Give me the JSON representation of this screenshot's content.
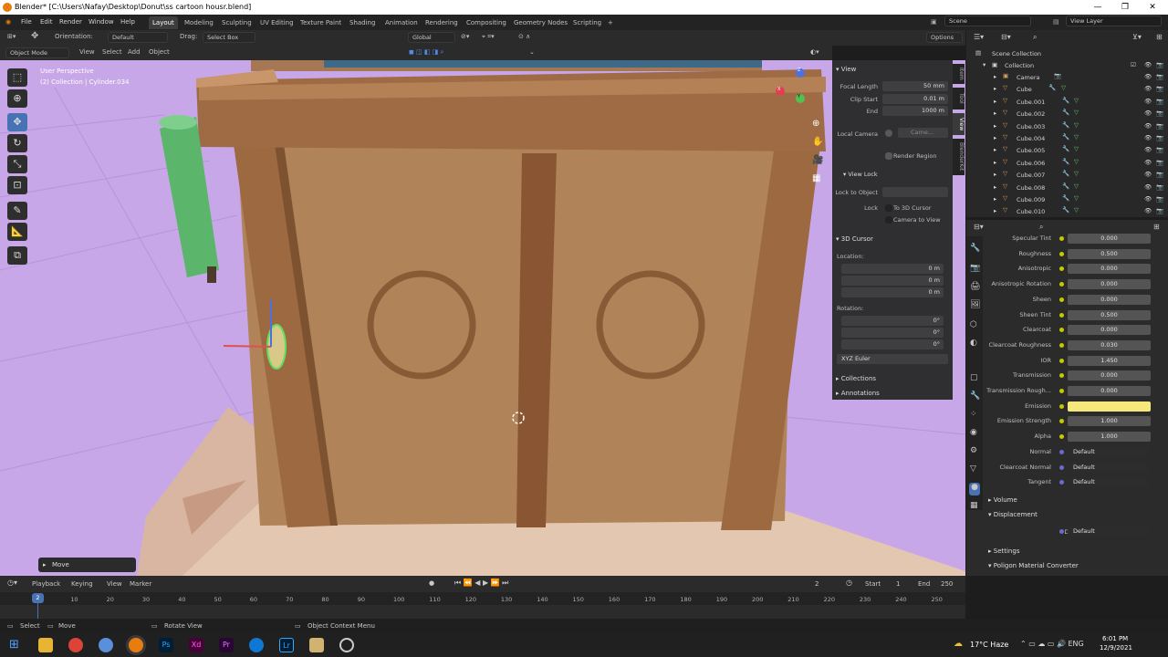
{
  "window": {
    "title": "Blender* [C:\\Users\\Nafay\\Desktop\\Donut\\ss cartoon housr.blend]"
  },
  "menu": [
    "File",
    "Edit",
    "Render",
    "Window",
    "Help"
  ],
  "workspaces": [
    "Layout",
    "Modeling",
    "Sculpting",
    "UV Editing",
    "Texture Paint",
    "Shading",
    "Animation",
    "Rendering",
    "Compositing",
    "Geometry Nodes",
    "Scripting",
    "+"
  ],
  "scene": {
    "label": "Scene",
    "view_layer": "View Layer"
  },
  "toolbar": {
    "orientation_label": "Orientation:",
    "orientation_value": "Default",
    "drag_label": "Drag:",
    "drag_value": "Select Box",
    "transform": "Global",
    "options": "Options"
  },
  "header2": {
    "mode": "Object Mode",
    "items": [
      "View",
      "Select",
      "Add",
      "Object"
    ]
  },
  "viewport": {
    "perspective": "User Perspective",
    "collection_info": "(2) Collection | Cylinder.034",
    "operator_panel": "Move",
    "gizmo": {
      "x": "X",
      "y": "Y",
      "z": "Z"
    }
  },
  "npanel": {
    "tabs": [
      "Item",
      "Tool",
      "View",
      "BlenderKit"
    ],
    "view_header": "View",
    "focal_length_label": "Focal Length",
    "focal_length": "50 mm",
    "clip_start_label": "Clip Start",
    "clip_start": "0.01 m",
    "end_label": "End",
    "end": "1000 m",
    "local_camera_label": "Local Camera",
    "local_camera_value": "Came...",
    "render_region": "Render Region",
    "view_lock": "View Lock",
    "lock_to_object_label": "Lock to Object",
    "lock_label": "Lock",
    "to_3d_cursor": "To 3D Cursor",
    "camera_to_view": "Camera to View",
    "cursor_header": "3D Cursor",
    "location_label": "Location:",
    "loc": [
      {
        "axis": "X",
        "value": "0 m"
      },
      {
        "axis": "Y",
        "value": "0 m"
      },
      {
        "axis": "Z",
        "value": "0 m"
      }
    ],
    "rotation_label": "Rotation:",
    "rot": [
      {
        "axis": "X",
        "value": "0°"
      },
      {
        "axis": "Y",
        "value": "0°"
      },
      {
        "axis": "Z",
        "value": "0°"
      }
    ],
    "rotation_mode": "XYZ Euler",
    "collections": "Collections",
    "annotations": "Annotations"
  },
  "outliner": {
    "scene_collection": "Scene Collection",
    "collection": "Collection",
    "items": [
      "Camera",
      "Cube",
      "Cube.001",
      "Cube.002",
      "Cube.003",
      "Cube.004",
      "Cube.005",
      "Cube.006",
      "Cube.007",
      "Cube.008",
      "Cube.009",
      "Cube.010"
    ]
  },
  "properties": {
    "rows": [
      {
        "label": "Specular Tint",
        "value": "0.000"
      },
      {
        "label": "Roughness",
        "value": "0.500"
      },
      {
        "label": "Anisotropic",
        "value": "0.000"
      },
      {
        "label": "Anisotropic Rotation",
        "value": "0.000"
      },
      {
        "label": "Sheen",
        "value": "0.000"
      },
      {
        "label": "Sheen Tint",
        "value": "0.500"
      },
      {
        "label": "Clearcoat",
        "value": "0.000"
      },
      {
        "label": "Clearcoat Roughness",
        "value": "0.030"
      },
      {
        "label": "IOR",
        "value": "1.450"
      },
      {
        "label": "Transmission",
        "value": "0.000"
      },
      {
        "label": "Transmission Rough...",
        "value": "0.000"
      },
      {
        "label": "Emission",
        "value": ""
      },
      {
        "label": "Emission Strength",
        "value": "1.000"
      },
      {
        "label": "Alpha",
        "value": "1.000"
      },
      {
        "label": "Normal",
        "value": "Default"
      },
      {
        "label": "Clearcoat Normal",
        "value": "Default"
      },
      {
        "label": "Tangent",
        "value": "Default"
      }
    ],
    "emission_color": "#f6e87a",
    "volume": "Volume",
    "displacement": "Displacement",
    "displacement_label": "Displacement",
    "displacement_value": "Default",
    "settings": "Settings",
    "poligon": "Poligon Material Converter"
  },
  "timeline": {
    "menu": [
      "Playback",
      "Keying",
      "View",
      "Marker"
    ],
    "current_frame": "2",
    "start_label": "Start",
    "start": "1",
    "end_label": "End",
    "end": "250",
    "ticks": [
      "0",
      "10",
      "20",
      "30",
      "40",
      "50",
      "60",
      "70",
      "80",
      "90",
      "100",
      "110",
      "120",
      "130",
      "140",
      "150",
      "160",
      "170",
      "180",
      "190",
      "200",
      "210",
      "220",
      "230",
      "240",
      "250"
    ],
    "frame_marker": "2"
  },
  "status": {
    "select": "Select",
    "move": "Move",
    "rotate": "Rotate View",
    "context": "Object Context Menu"
  },
  "taskbar": {
    "weather": "17°C  Haze",
    "time": "6:01 PM",
    "date": "12/9/2021"
  },
  "colors": {
    "accent": "#4772b3",
    "wall": "#b08358",
    "frame": "#9c6940",
    "floor": "#e4c7b0",
    "background": "#c7a7e8",
    "cylinder": "#5bb56a"
  }
}
